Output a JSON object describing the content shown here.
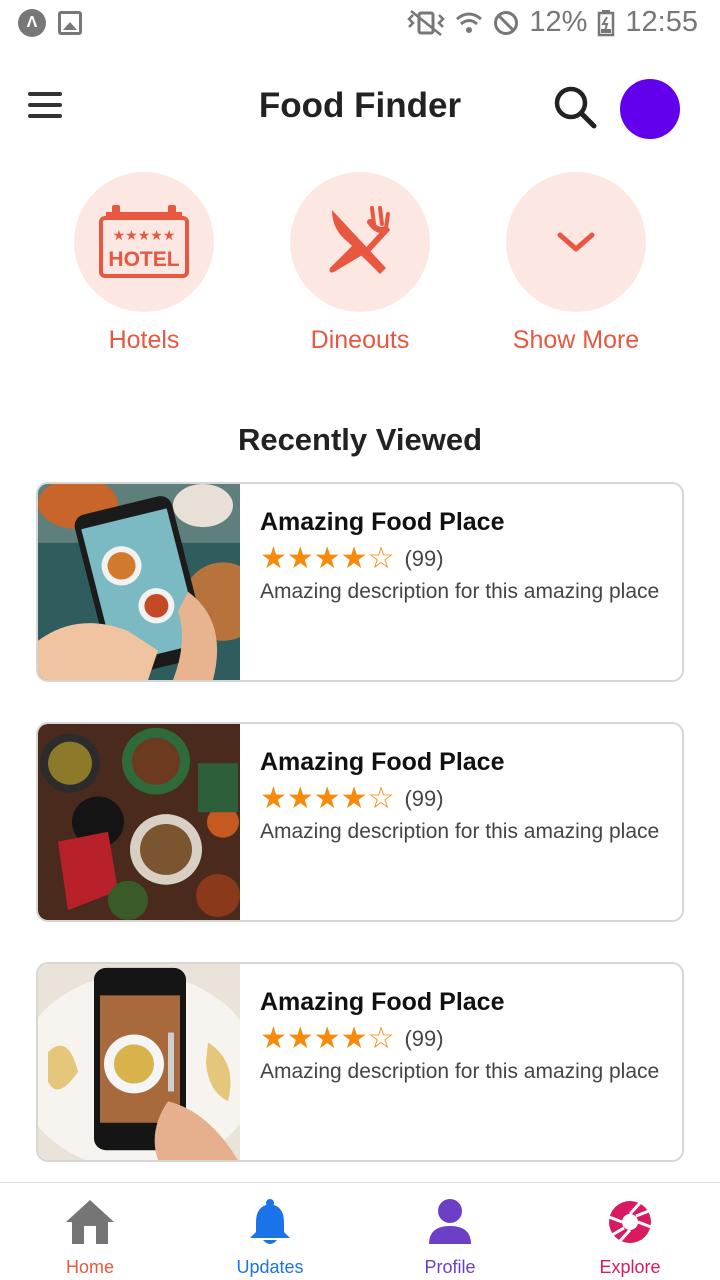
{
  "status_bar": {
    "battery": "12%",
    "time": "12:55"
  },
  "app_bar": {
    "title": "Food Finder"
  },
  "categories": [
    {
      "label": "Hotels",
      "icon": "hotel-sign-icon",
      "hotel_text": "HOTEL"
    },
    {
      "label": "Dineouts",
      "icon": "fork-knife-icon"
    },
    {
      "label": "Show More",
      "icon": "chevron-down-icon"
    }
  ],
  "section": {
    "title": "Recently Viewed"
  },
  "places": [
    {
      "title": "Amazing Food Place",
      "stars": "★★★★☆",
      "rating": 4,
      "count": "(99)",
      "description": "Amazing description for this amazing place",
      "image": "phone-photographing-food"
    },
    {
      "title": "Amazing Food Place",
      "stars": "★★★★☆",
      "rating": 4,
      "count": "(99)",
      "description": "Amazing description for this amazing place",
      "image": "table-of-dishes"
    },
    {
      "title": "Amazing Food Place",
      "stars": "★★★★☆",
      "rating": 4,
      "count": "(99)",
      "description": "Amazing description for this amazing place",
      "image": "phone-photographing-pasta"
    }
  ],
  "bottom_nav": [
    {
      "label": "Home",
      "color": "#e8573f",
      "icon_color": "#757575",
      "icon": "home-icon"
    },
    {
      "label": "Updates",
      "color": "#1a73e8",
      "icon_color": "#1a73e8",
      "icon": "bell-icon"
    },
    {
      "label": "Profile",
      "color": "#6c3fc7",
      "icon_color": "#6c3fc7",
      "icon": "person-icon"
    },
    {
      "label": "Explore",
      "color": "#d81b60",
      "icon_color": "#d81b60",
      "icon": "aperture-icon"
    }
  ],
  "colors": {
    "accent": "#e8573f",
    "accent_bg": "#fde7e2",
    "star": "#f58a0b",
    "avatar": "#6200ee"
  }
}
